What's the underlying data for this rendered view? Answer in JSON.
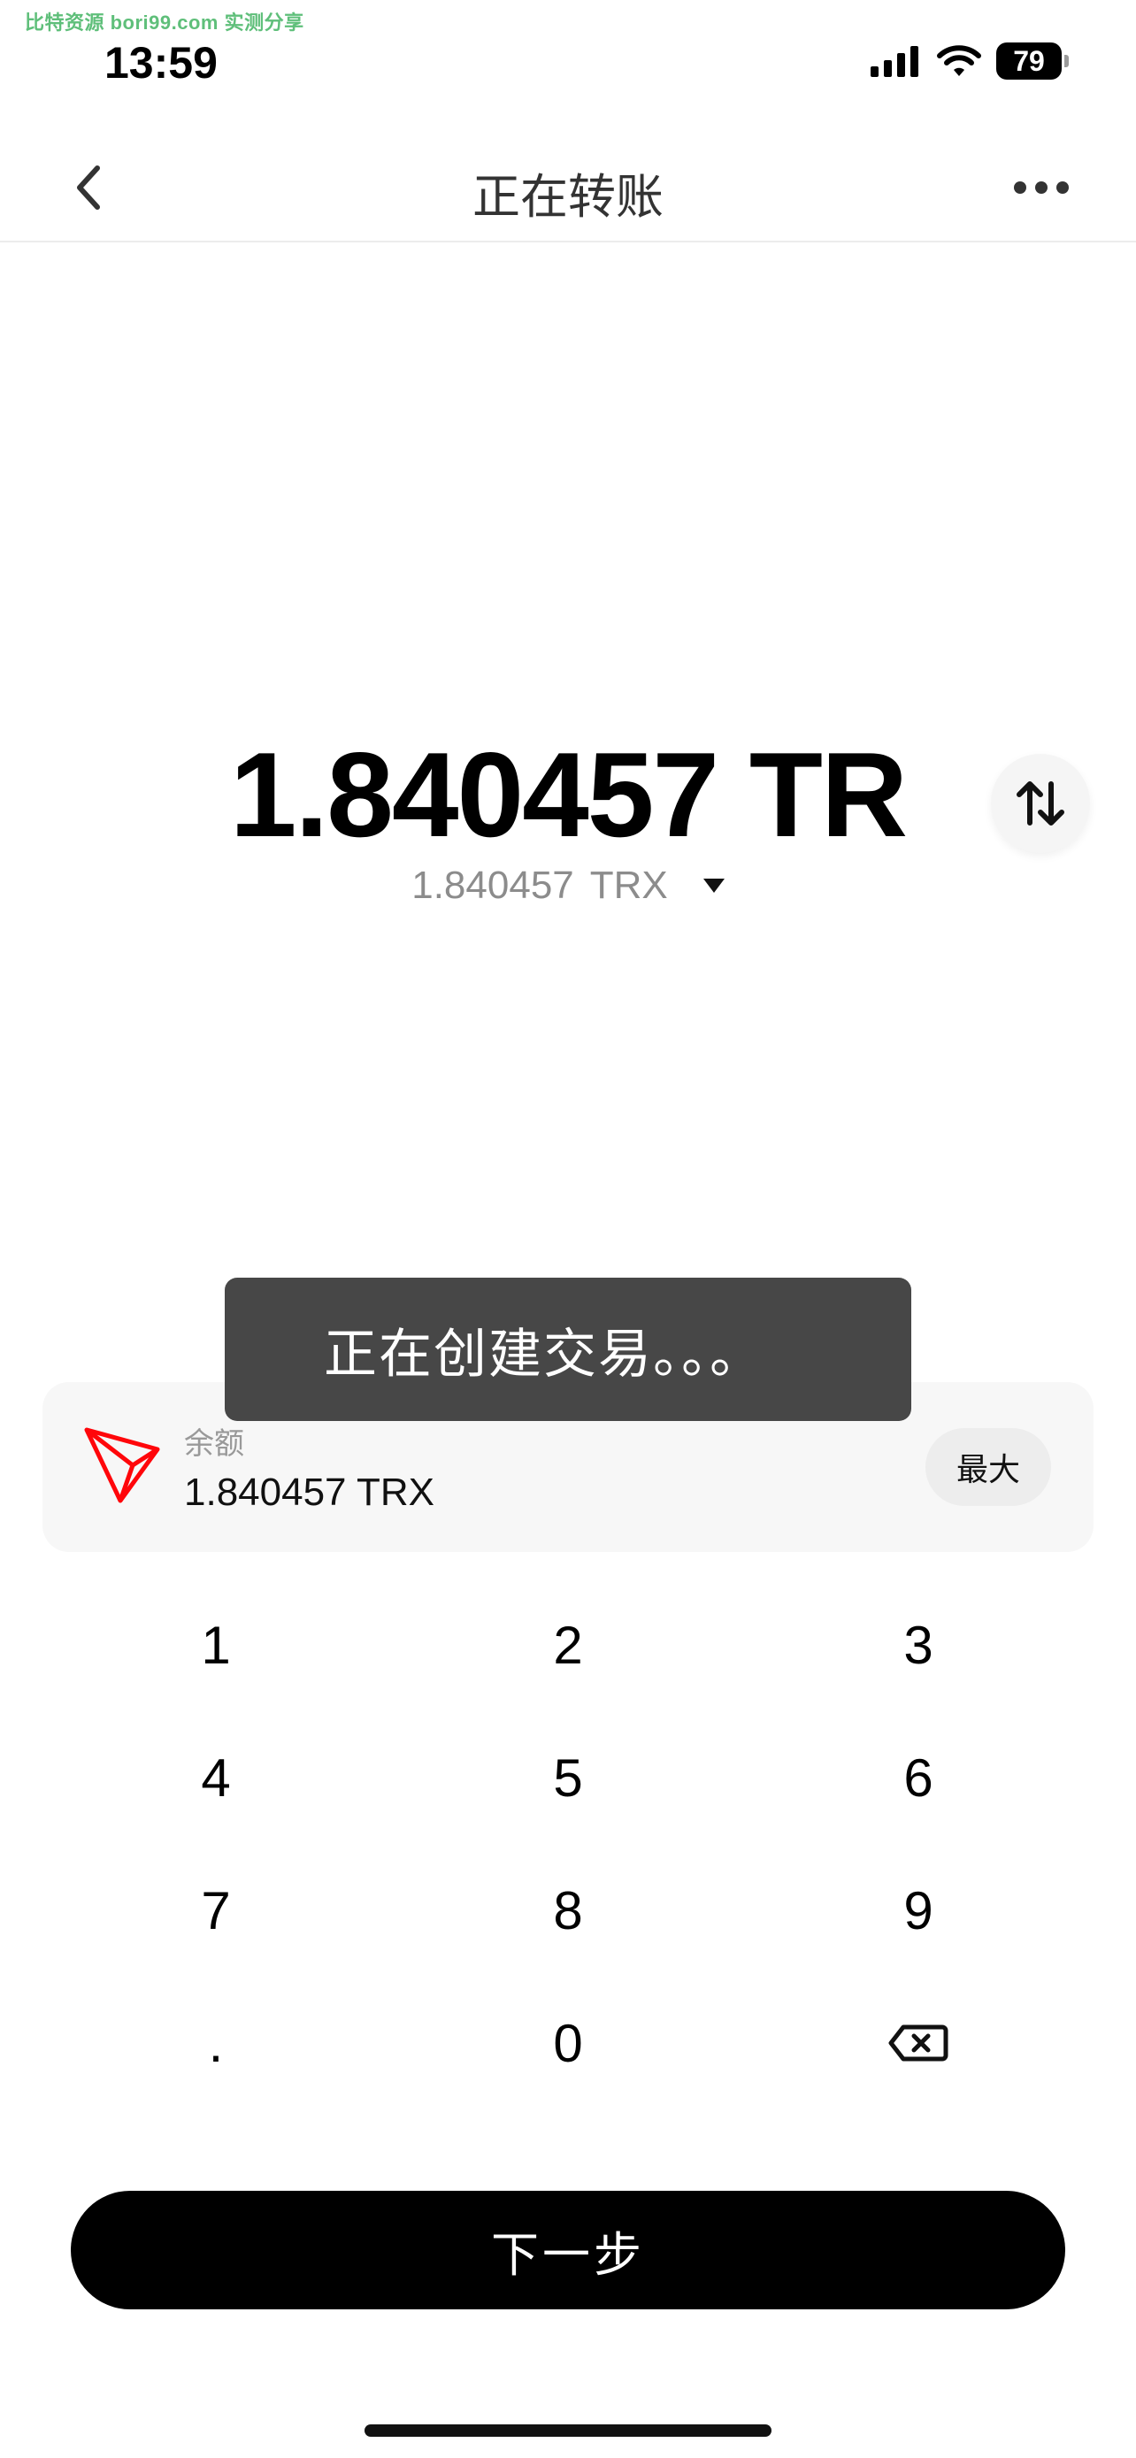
{
  "watermark": "比特资源 bori99.com 实测分享",
  "status_bar": {
    "time": "13:59",
    "battery": "79"
  },
  "header": {
    "title": "正在转账"
  },
  "amount": {
    "main": "1.840457 TR",
    "sub_value": "1.840457",
    "sub_unit": "TRX"
  },
  "toast": {
    "text": "正在创建交易。。。"
  },
  "balance": {
    "label": "余额",
    "value": "1.840457 TRX",
    "max_label": "最大"
  },
  "keypad": {
    "keys": [
      "1",
      "2",
      "3",
      "4",
      "5",
      "6",
      "7",
      "8",
      "9",
      ".",
      "0"
    ]
  },
  "next_button": {
    "label": "下一步"
  },
  "colors": {
    "tron_red": "#ff060a",
    "toast_bg": "#3c3c3c",
    "button_bg": "#000000"
  }
}
